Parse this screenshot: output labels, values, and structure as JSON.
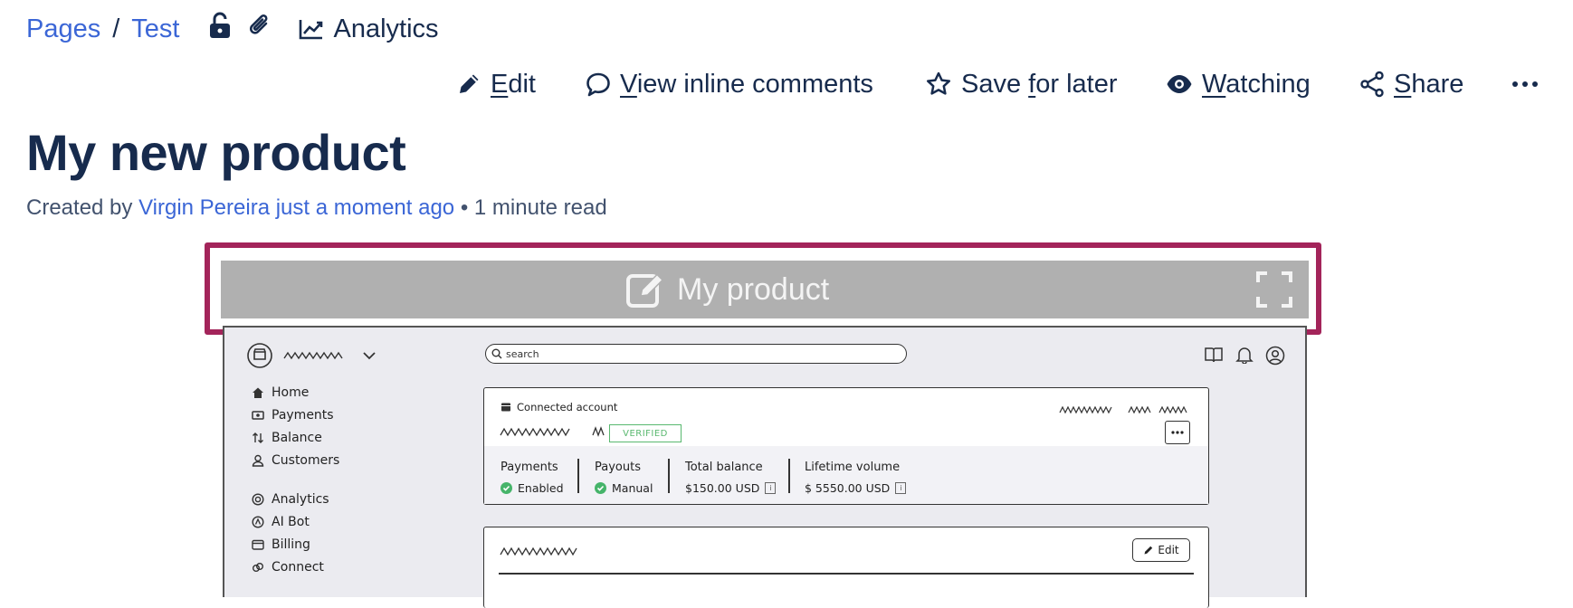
{
  "breadcrumb": {
    "root": "Pages",
    "separator": "/",
    "current": "Test",
    "analytics": "Analytics"
  },
  "actions": {
    "edit": {
      "first": "E",
      "rest": "dit"
    },
    "comments": {
      "first": "V",
      "rest": "iew inline comments"
    },
    "save": {
      "pre": "Save ",
      "u": "f",
      "post": "or later"
    },
    "watching": {
      "first": "W",
      "rest": "atching"
    },
    "share": {
      "first": "S",
      "rest": "hare"
    }
  },
  "page": {
    "title": "My new product",
    "created_by": "Created by ",
    "author": "Virgin Pereira",
    "time": "just a moment ago",
    "dot": " • ",
    "read_time": "1 minute read"
  },
  "embed": {
    "title": "My product",
    "mockup": {
      "search_placeholder": "search",
      "nav": [
        "Home",
        "Payments",
        "Balance",
        "Customers",
        "Analytics",
        "AI Bot",
        "Billing",
        "Connect"
      ],
      "connected_account": "Connected account",
      "verified": "VERIFIED",
      "stats": [
        {
          "label": "Payments",
          "value": "Enabled"
        },
        {
          "label": "Payouts",
          "value": "Manual"
        },
        {
          "label": "Total balance",
          "value": "$150.00 USD"
        },
        {
          "label": "Lifetime volume",
          "value": "$ 5550.00 USD"
        }
      ],
      "edit_button": "Edit"
    }
  },
  "colors": {
    "link": "#3b66d6",
    "text": "#172b4d",
    "frame": "#a3245a",
    "header_bg": "#b0b0b0"
  }
}
